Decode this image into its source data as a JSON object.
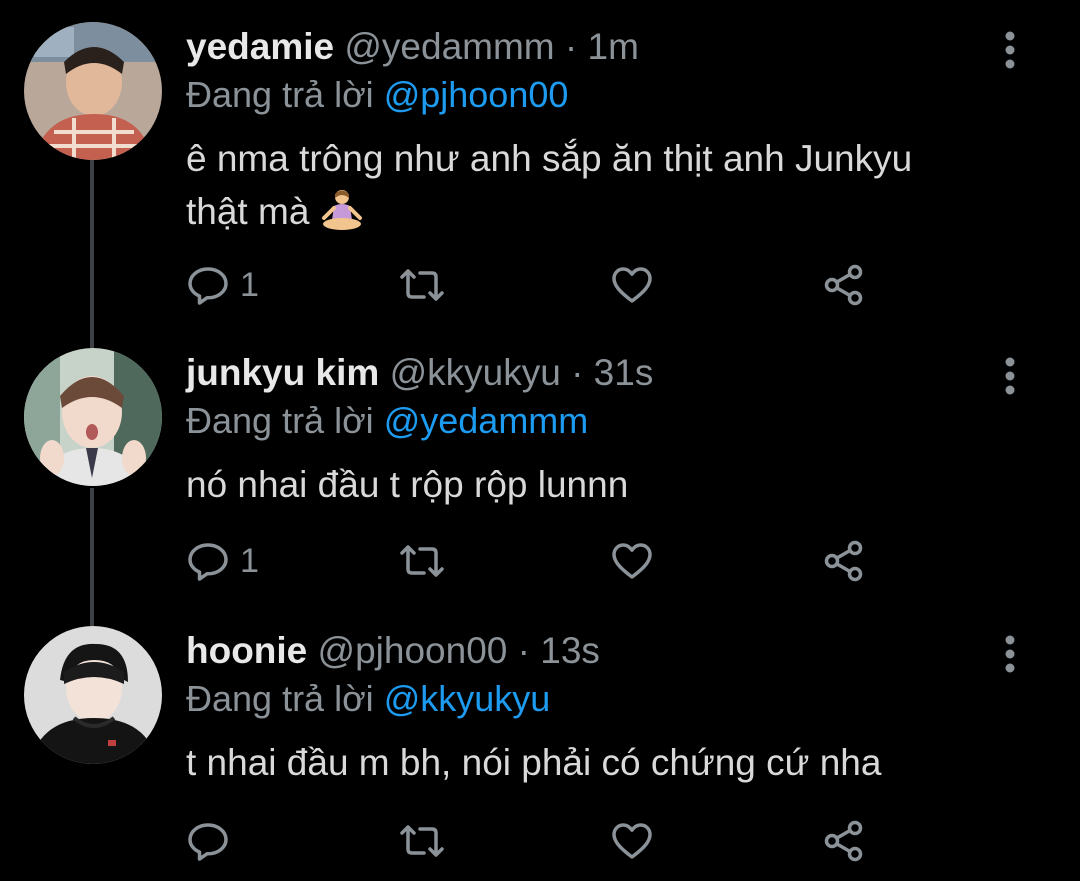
{
  "colors": {
    "background": "#000000",
    "text": "#d9d9d9",
    "secondary": "#8b9298",
    "mention": "#1d9bf0",
    "thread_line": "#3d4146"
  },
  "tweets": [
    {
      "display_name": "yedamie",
      "handle": "@yedammm",
      "separator": "·",
      "time": "1m",
      "replying_label": "Đang trả lời",
      "replying_to": "@pjhoon00",
      "text_line1": "ê nma trông như anh sắp ăn thịt anh Junkyu",
      "text_line2": "thật mà",
      "emoji_icon": "person-in-lotus-position-icon",
      "reply_count": "1",
      "retweet_count": "",
      "like_count": ""
    },
    {
      "display_name": "junkyu kim",
      "handle": "@kkyukyu",
      "separator": "·",
      "time": "31s",
      "replying_label": "Đang trả lời",
      "replying_to": "@yedammm",
      "text_line1": "nó nhai đầu t rộp rộp lunnn",
      "reply_count": "1",
      "retweet_count": "",
      "like_count": ""
    },
    {
      "display_name": "hoonie",
      "handle": "@pjhoon00",
      "separator": "·",
      "time": "13s",
      "replying_label": "Đang trả lời",
      "replying_to": "@kkyukyu",
      "text_line1": "t nhai đầu m bh, nói phải có chứng cứ nha",
      "reply_count": "",
      "retweet_count": "",
      "like_count": ""
    }
  ],
  "icons": {
    "reply": "reply-icon",
    "retweet": "retweet-icon",
    "like": "heart-icon",
    "share": "share-icon",
    "more": "more-vertical-icon"
  }
}
